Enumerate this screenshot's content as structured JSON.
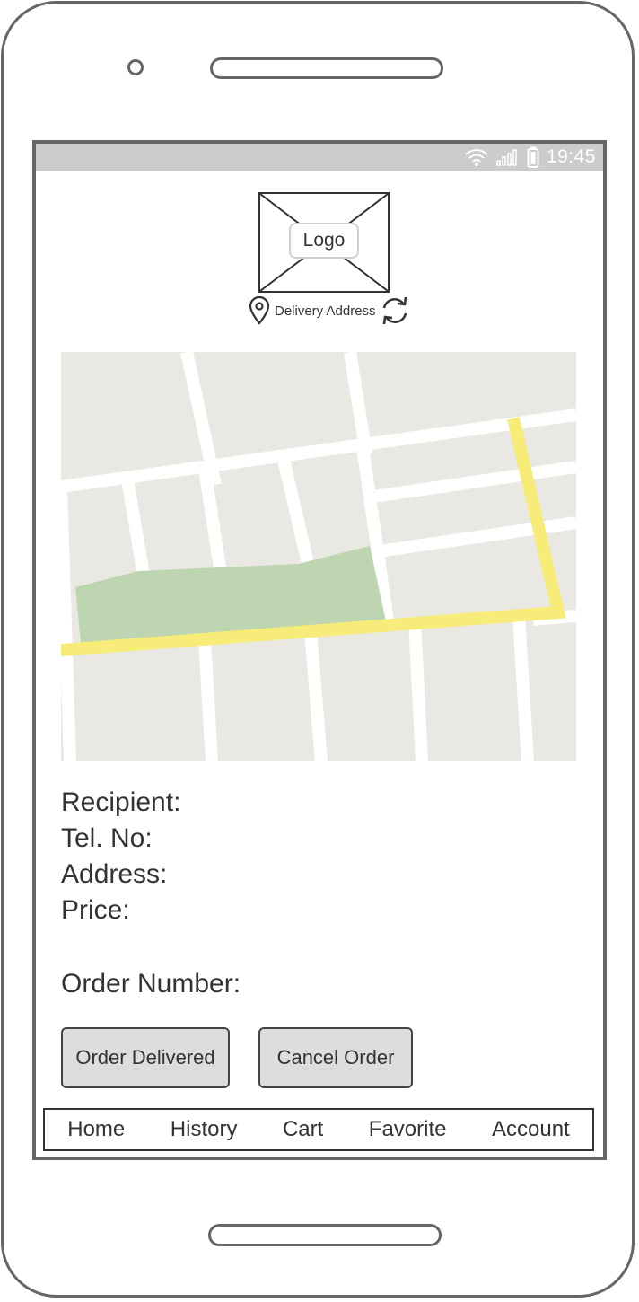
{
  "status_bar": {
    "time": "19:45",
    "icons": [
      "wifi-icon",
      "signal-icon",
      "battery-icon"
    ]
  },
  "header": {
    "logo_label": "Logo",
    "delivery_address_label": "Delivery Address",
    "icons": [
      "location-pin-icon",
      "refresh-icon"
    ]
  },
  "map": {
    "kind": "static-map"
  },
  "details": {
    "recipient_label": "Recipient:",
    "tel_label": "Tel. No:",
    "address_label": "Address:",
    "price_label": "Price:",
    "order_number_label": "Order Number:"
  },
  "actions": {
    "delivered_label": "Order Delivered",
    "cancel_label": "Cancel Order"
  },
  "nav": {
    "items": [
      {
        "label": "Home"
      },
      {
        "label": "History"
      },
      {
        "label": "Cart"
      },
      {
        "label": "Favorite"
      },
      {
        "label": "Account"
      }
    ]
  },
  "colors": {
    "frame": "#666666",
    "status_bar": "#cccccc",
    "map_background": "#eae8e2",
    "map_park": "#bdd5b0",
    "map_route": "#f7ec7a",
    "button_fill": "#dddddd"
  }
}
